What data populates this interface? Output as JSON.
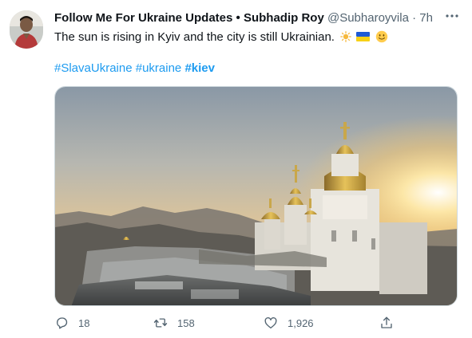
{
  "tweet": {
    "display_name": "Follow Me For Ukraine Updates • Subhadip Roy",
    "handle": "@Subharoyvila",
    "separator": "·",
    "time": "7h",
    "text": "The sun is rising in Kyiv and the city is still Ukrainian.",
    "emojis": [
      "sun-emoji",
      "ukraine-flag-emoji",
      "smiling-face-emoji"
    ],
    "hashtags": [
      "#SlavaUkraine",
      "#ukraine",
      "#kiev"
    ]
  },
  "actions": {
    "reply_count": "18",
    "retweet_count": "158",
    "like_count": "1,926"
  },
  "icons": {
    "reply": "reply-icon",
    "retweet": "retweet-icon",
    "like": "like-icon",
    "share": "share-icon",
    "more": "more-icon"
  },
  "colors": {
    "accent": "#1d9bf0",
    "text": "#0f1419",
    "muted": "#536471"
  }
}
